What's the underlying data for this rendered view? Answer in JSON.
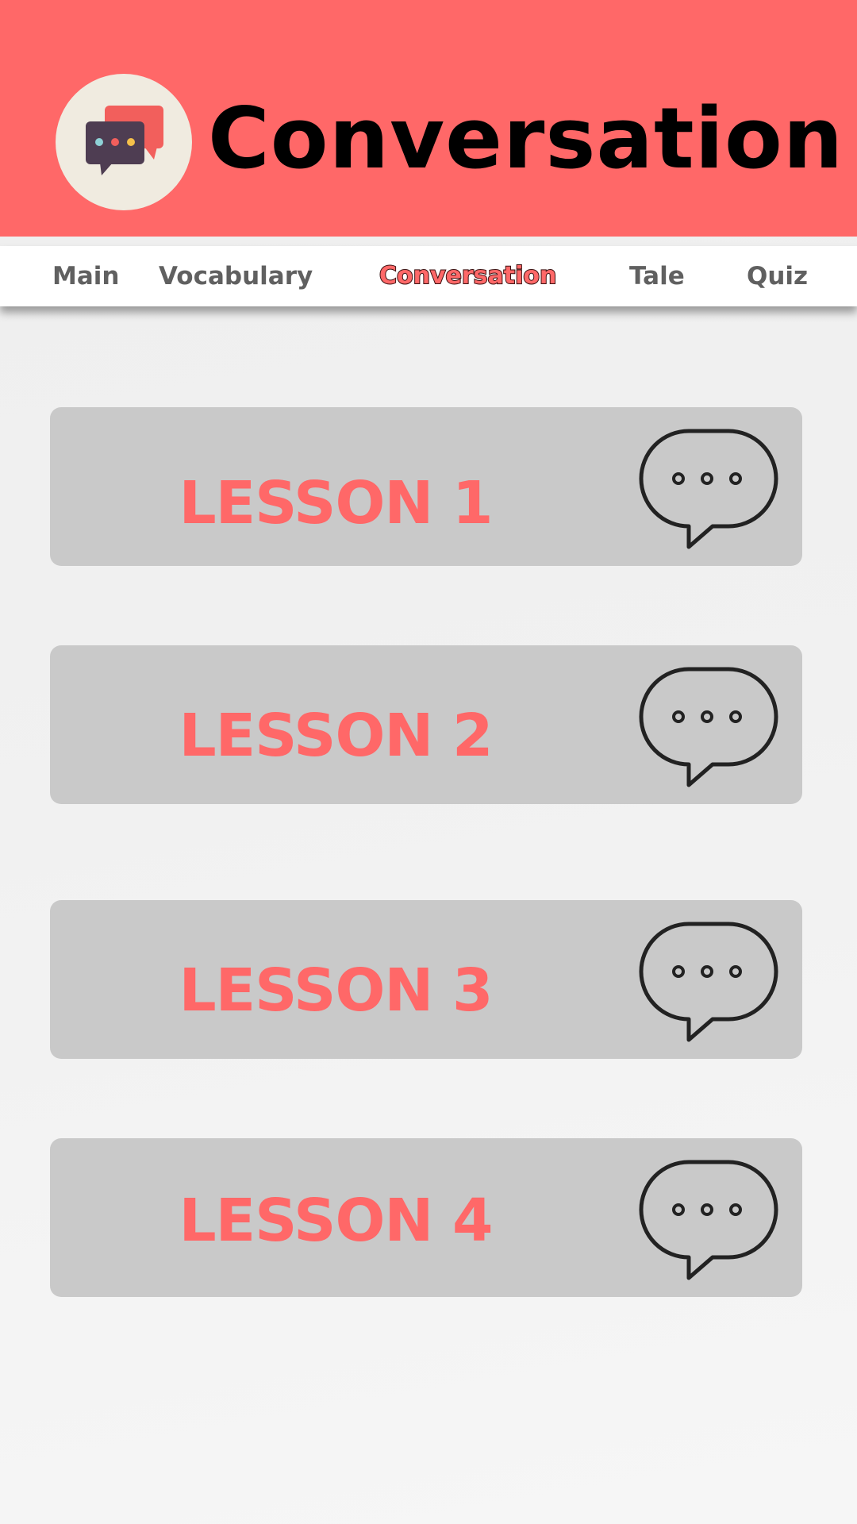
{
  "header": {
    "title": "Conversation",
    "logo_icon": "chat-bubbles-icon"
  },
  "tabs": [
    {
      "label": "Main",
      "active": false
    },
    {
      "label": "Vocabulary",
      "active": false
    },
    {
      "label": "Conversation",
      "active": true
    },
    {
      "label": "Tale",
      "active": false
    },
    {
      "label": "Quiz",
      "active": false
    }
  ],
  "lessons": [
    {
      "label": "LESSON 1",
      "icon": "speech-bubble-icon"
    },
    {
      "label": "LESSON 2",
      "icon": "speech-bubble-icon"
    },
    {
      "label": "LESSON 3",
      "icon": "speech-bubble-icon"
    },
    {
      "label": "LESSON 4",
      "icon": "speech-bubble-icon"
    }
  ],
  "colors": {
    "accent": "#ff6868",
    "card": "#c9c9c9",
    "logo_bg": "#f0ebe0"
  }
}
